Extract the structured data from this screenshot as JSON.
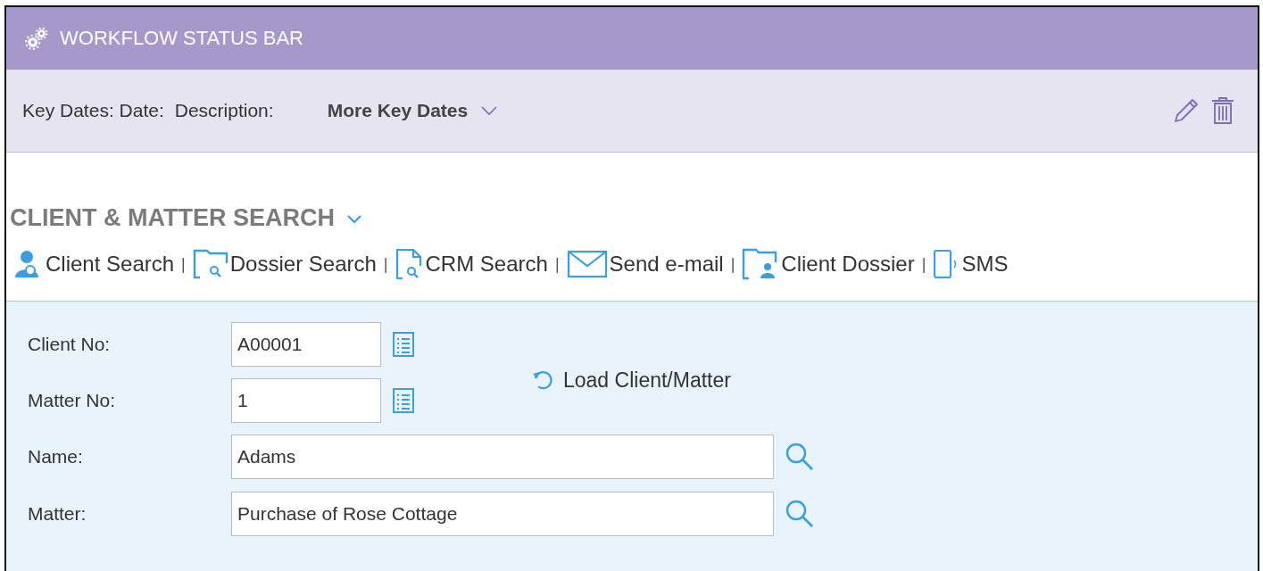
{
  "header": {
    "title": "WORKFLOW STATUS BAR"
  },
  "key_dates": {
    "labels": [
      "Key Dates: Date:",
      "Description:"
    ],
    "more": "More Key Dates"
  },
  "section": {
    "title": "CLIENT & MATTER SEARCH",
    "expanded": true
  },
  "links": [
    {
      "label": "Client Search",
      "kind": "person"
    },
    {
      "label": "Dossier Search",
      "kind": "folder-search"
    },
    {
      "label": "CRM Search",
      "kind": "doc-search"
    },
    {
      "label": "Send e-mail",
      "kind": "mail"
    },
    {
      "label": "Client Dossier",
      "kind": "folder-person"
    },
    {
      "label": "SMS",
      "kind": "phone"
    }
  ],
  "separator": "|",
  "short_fields": [
    {
      "label": "Client No:",
      "value": "A00001"
    },
    {
      "label": "Matter No:",
      "value": "1"
    }
  ],
  "load_button": "Load Client/Matter",
  "long_fields": [
    {
      "label": "Name:",
      "value": "Adams"
    },
    {
      "label": "Matter:",
      "value": "Purchase of Rose Cottage"
    }
  ]
}
